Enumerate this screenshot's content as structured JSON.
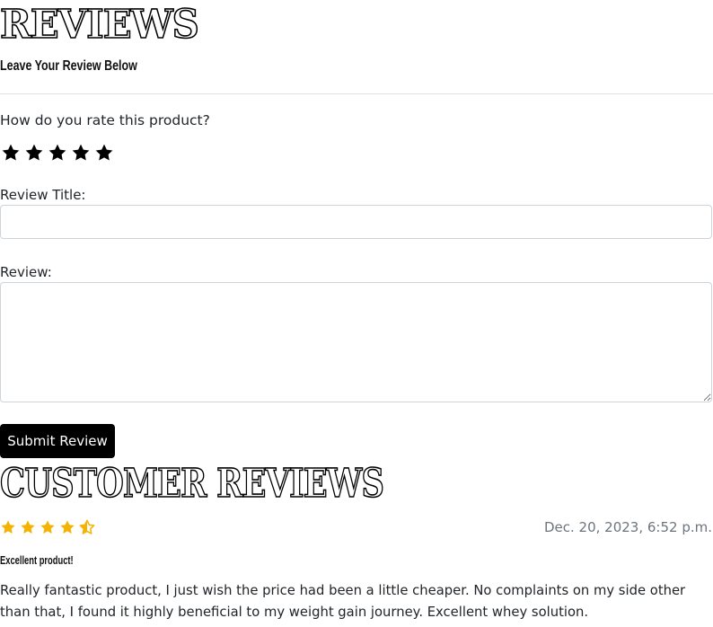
{
  "reviews_section": {
    "heading": "Reviews",
    "subtitle": "Leave Your Review Below",
    "rating_prompt": "How do you rate this product?",
    "rating_stars": [
      1,
      2,
      3,
      4,
      5
    ],
    "title_label": "Review Title:",
    "title_value": "",
    "review_label": "Review:",
    "review_value": "",
    "submit_label": "Submit Review"
  },
  "customer_reviews": {
    "heading": "Customer Reviews",
    "items": [
      {
        "rating": 4.5,
        "rating_max": 5,
        "date": "Dec. 20, 2023, 6:52 p.m.",
        "title": "Excellent product!",
        "body": "Really fantastic product, I just wish the price had been a little cheaper. No complaints on my side other than that, I found it highly beneficial to my weight gain journey. Excellent whey solution."
      }
    ]
  },
  "colors": {
    "star_input": "#000000",
    "star_rating": "#f5b301",
    "button_bg": "#000000",
    "date_text": "#6c757d"
  },
  "icons": {
    "rating_input": "star-icon",
    "rating_full": "star-filled-icon",
    "rating_half": "star-half-icon"
  }
}
